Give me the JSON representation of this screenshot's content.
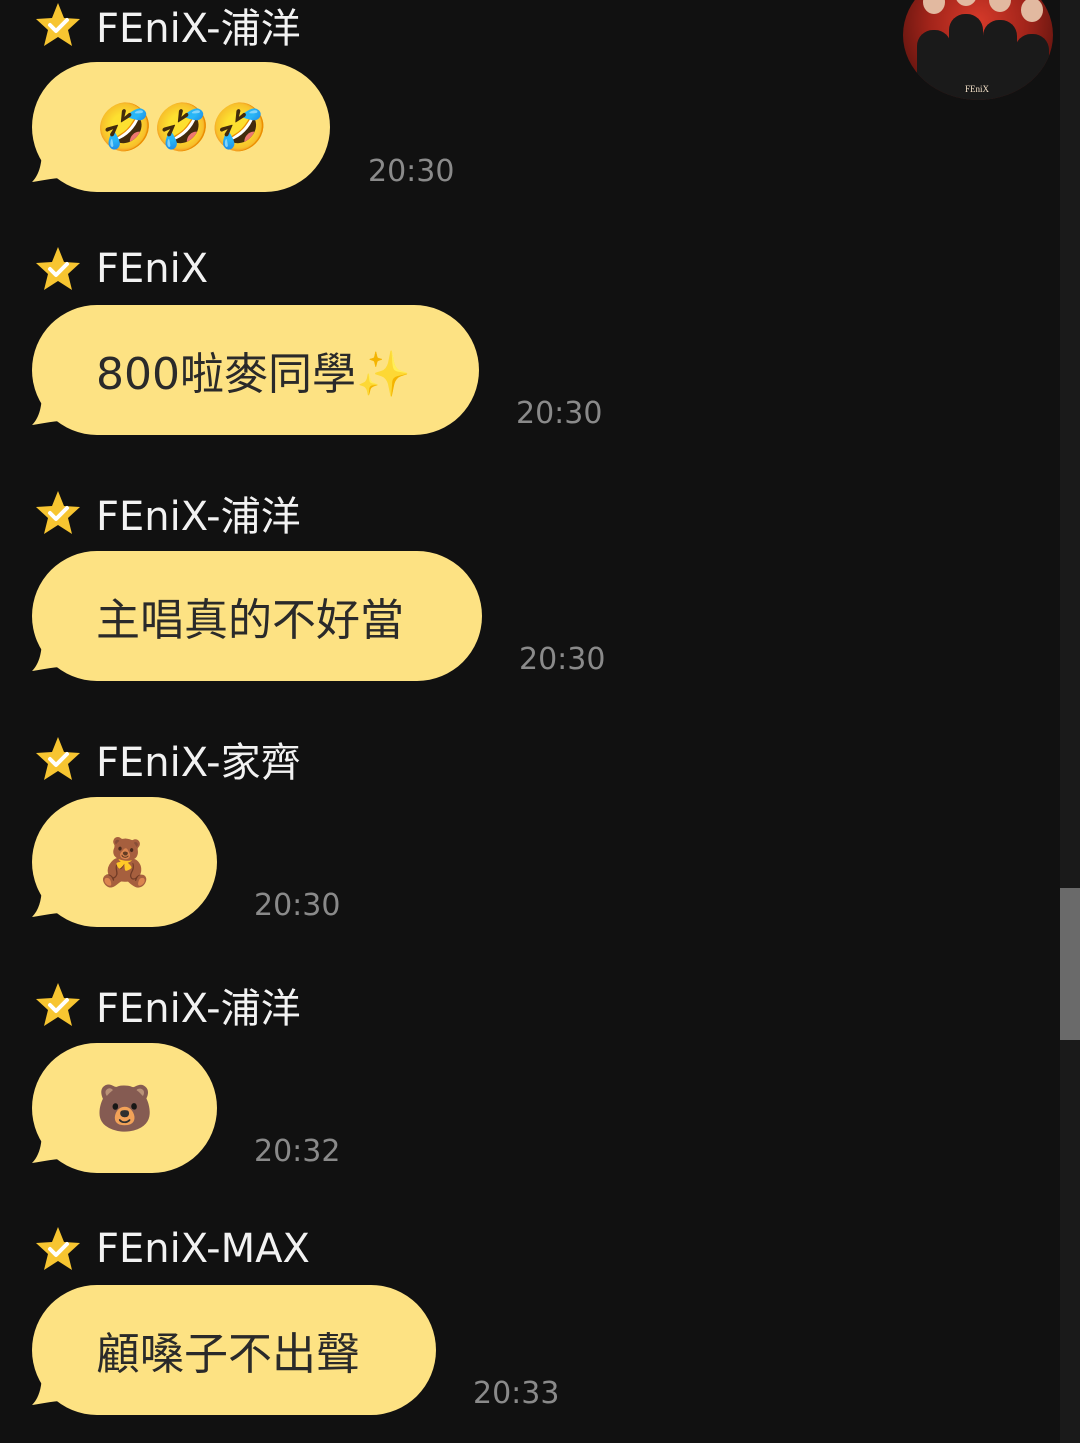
{
  "chat": {
    "messages": [
      {
        "sender": "FEniX-浦洋",
        "text": "🤣🤣🤣",
        "time": "20:30"
      },
      {
        "sender": "FEniX",
        "text": "800啦麥同學✨",
        "time": "20:30"
      },
      {
        "sender": "FEniX-浦洋",
        "text": "主唱真的不好當",
        "time": "20:30"
      },
      {
        "sender": "FEniX-家齊",
        "text": "🧸",
        "time": "20:30"
      },
      {
        "sender": "FEniX-浦洋",
        "text": "🐻",
        "time": "20:32"
      },
      {
        "sender": "FEniX-MAX",
        "text": "顧嗓子不出聲",
        "time": "20:33"
      }
    ],
    "avatar": {
      "logo": "FEniX"
    }
  },
  "colors": {
    "background": "#111111",
    "bubble": "#fde283",
    "star": "#f7c531",
    "timestamp": "#8a8a8a",
    "name": "#f2f2f2"
  },
  "icons": {
    "verified": "star-check-icon"
  }
}
